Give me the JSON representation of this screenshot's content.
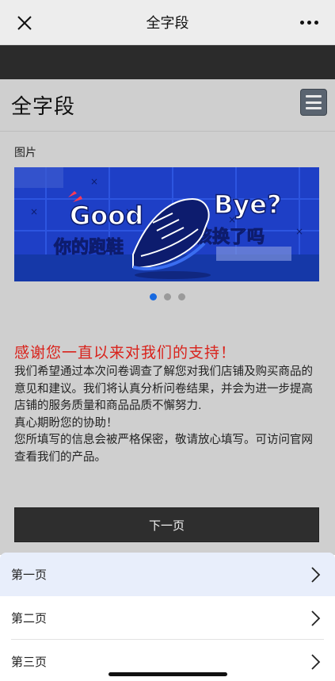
{
  "topbar": {
    "title": "全字段",
    "close_icon": "close-icon",
    "more_icon": "more-icon"
  },
  "page": {
    "title": "全字段",
    "menu_icon": "hamburger-icon"
  },
  "image_section": {
    "label": "图片",
    "banner": {
      "word_left": "Good",
      "word_right": "Bye?",
      "subtitle_left": "你的跑鞋",
      "subtitle_right": "该换了吗",
      "colors": {
        "bg": "#1e3fc6",
        "accent": "#ff3a55",
        "text": "#ffffff"
      }
    },
    "carousel": {
      "count": 3,
      "active_index": 0
    }
  },
  "thanks": "感谢您一直以来对我们的支持！",
  "description": [
    "我们希望通过本次问卷调查了解您对我们店铺及购买商品的意见和建议。我们将认真分析问卷结果，并会为进一步提高店铺的服务质量和商品品质不懈努力.",
    "真心期盼您的协助！",
    "您所填写的信息会被严格保密，敬请放心填写。可访问官网查看我们的产品。"
  ],
  "next_button": "下一页",
  "page_list": [
    {
      "label": "第一页",
      "active": true
    },
    {
      "label": "第二页",
      "active": false
    },
    {
      "label": "第三页",
      "active": false
    }
  ],
  "colors": {
    "accent_red": "#d9221b",
    "dot_active": "#1769e0"
  }
}
